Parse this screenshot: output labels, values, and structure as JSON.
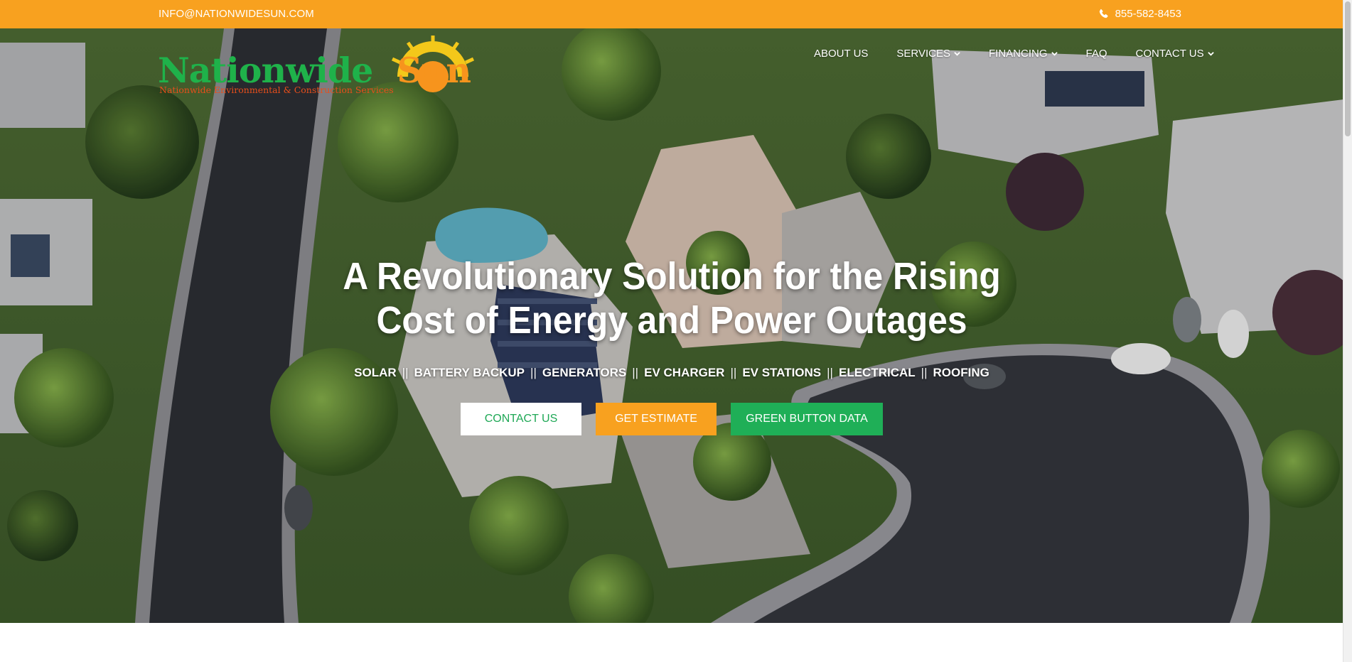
{
  "topbar": {
    "email": "INFO@NATIONWIDESUN.COM",
    "phone": "855-582-8453",
    "background": "#f8a11f"
  },
  "logo": {
    "word_part1": "Nationwide",
    "word_part2": "Sun",
    "tagline": "Nationwide Environmental & Construction Services"
  },
  "nav": {
    "items": [
      {
        "label": "ABOUT US",
        "dropdown": false
      },
      {
        "label": "SERVICES",
        "dropdown": true
      },
      {
        "label": "FINANCING",
        "dropdown": true
      },
      {
        "label": "FAQ",
        "dropdown": false
      },
      {
        "label": "CONTACT US",
        "dropdown": true
      }
    ]
  },
  "hero": {
    "headline_line1": "A Revolutionary Solution for the Rising",
    "headline_line2": "Cost of Energy and Power Outages",
    "services": [
      "SOLAR",
      "BATTERY BACKUP",
      "GENERATORS",
      "EV CHARGER",
      "EV STATIONS",
      "ELECTRICAL",
      "ROOFING"
    ],
    "separator": "||",
    "buttons": {
      "contact": "CONTACT US",
      "estimate": "GET ESTIMATE",
      "green_button": "GREEN BUTTON DATA"
    }
  },
  "colors": {
    "brand_orange": "#f8a11f",
    "brand_green": "#1faf57"
  },
  "icons": {
    "phone": "phone-icon",
    "chevron": "chevron-down-icon",
    "logo_sun": "sun-icon"
  }
}
